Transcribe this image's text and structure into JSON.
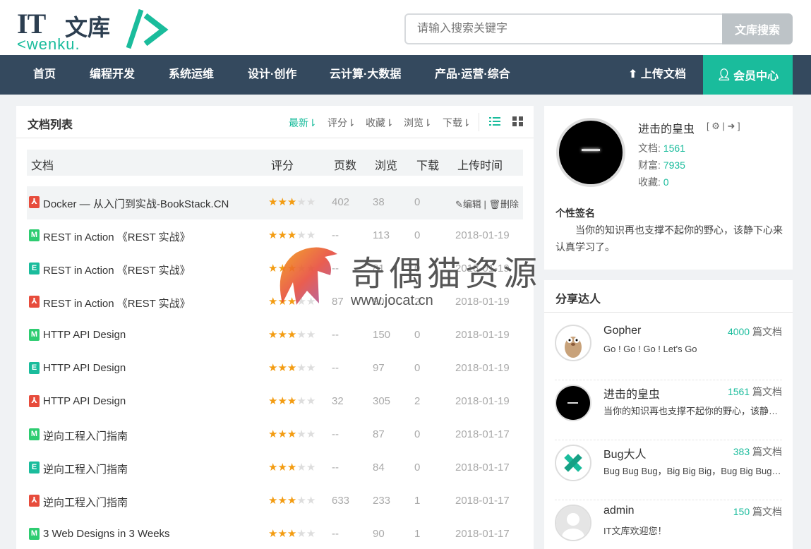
{
  "logo": {
    "brand_cn": "文库",
    "brand_en": "<wenku.",
    "brand_it": "IT"
  },
  "search": {
    "placeholder": "请输入搜索关键字",
    "button": "文库搜索"
  },
  "nav": {
    "items": [
      "首页",
      "编程开发",
      "系统运维",
      "设计·创作",
      "云计算·大数据",
      "产品·运营·综合"
    ],
    "upload": "上传文档",
    "member": "会员中心"
  },
  "doclist": {
    "title": "文档列表",
    "sorts": [
      "最新",
      "评分",
      "收藏",
      "浏览",
      "下载"
    ],
    "columns": [
      "文档",
      "评分",
      "页数",
      "浏览",
      "下载",
      "上传时间"
    ],
    "edit_label": "编辑",
    "delete_label": "删除",
    "rows": [
      {
        "type": "pdf",
        "title": "Docker — 从入门到实战-BookStack.CN",
        "rating": 3,
        "pages": "402",
        "views": "38",
        "downloads": "0",
        "date": ""
      },
      {
        "type": "md",
        "title": "REST in Action 《REST 实战》",
        "rating": 3,
        "pages": "--",
        "views": "113",
        "downloads": "0",
        "date": "2018-01-19"
      },
      {
        "type": "ep",
        "title": "REST in Action 《REST 实战》",
        "rating": 3,
        "pages": "--",
        "views": "81",
        "downloads": "0",
        "date": "2018-01-19"
      },
      {
        "type": "pdf",
        "title": "REST in Action 《REST 实战》",
        "rating": 3,
        "pages": "87",
        "views": "90",
        "downloads": "2",
        "date": "2018-01-19"
      },
      {
        "type": "md",
        "title": "HTTP API Design",
        "rating": 3,
        "pages": "--",
        "views": "150",
        "downloads": "0",
        "date": "2018-01-19"
      },
      {
        "type": "ep",
        "title": "HTTP API Design",
        "rating": 3,
        "pages": "--",
        "views": "97",
        "downloads": "0",
        "date": "2018-01-19"
      },
      {
        "type": "pdf",
        "title": "HTTP API Design",
        "rating": 3,
        "pages": "32",
        "views": "305",
        "downloads": "2",
        "date": "2018-01-19"
      },
      {
        "type": "md",
        "title": "逆向工程入门指南",
        "rating": 3,
        "pages": "--",
        "views": "87",
        "downloads": "0",
        "date": "2018-01-17"
      },
      {
        "type": "ep",
        "title": "逆向工程入门指南",
        "rating": 3,
        "pages": "--",
        "views": "84",
        "downloads": "0",
        "date": "2018-01-17"
      },
      {
        "type": "pdf",
        "title": "逆向工程入门指南",
        "rating": 3,
        "pages": "633",
        "views": "233",
        "downloads": "1",
        "date": "2018-01-17"
      },
      {
        "type": "md",
        "title": "3 Web Designs in 3 Weeks",
        "rating": 3,
        "pages": "--",
        "views": "90",
        "downloads": "1",
        "date": "2018-01-17"
      }
    ]
  },
  "profile": {
    "name": "进击的皇虫",
    "docs_label": "文档:",
    "docs": "1561",
    "wealth_label": "财富:",
    "wealth": "7935",
    "fav_label": "收藏:",
    "fav": "0",
    "sig_title": "个性签名",
    "signature": "当你的知识再也支撑不起你的野心，该静下心来认真学习了。"
  },
  "share": {
    "title": "分享达人",
    "unit": "篇文档",
    "users": [
      {
        "name": "Gopher",
        "count": "4000",
        "desc": "Go ! Go ! Go ! Let's Go",
        "avatar": "gopher-avatar"
      },
      {
        "name": "进击的皇虫",
        "count": "1561",
        "desc": "当你的知识再也支撑不起你的野心，该静下心来认真学习了。",
        "avatar": "dark-avatar"
      },
      {
        "name": "Bug大人",
        "count": "383",
        "desc": "Bug Bug Bug，Big Big Big，Bug Big Bug Big",
        "avatar": "tools-avatar"
      },
      {
        "name": "admin",
        "count": "150",
        "desc": "IT文库欢迎您！",
        "avatar": "default-avatar"
      }
    ]
  },
  "watermark": {
    "text": "奇偶猫资源",
    "url": "www.jocat.cn"
  },
  "colors": {
    "accent": "#1abc9c",
    "nav": "#34495e",
    "star": "#f39c12",
    "pdf": "#e74c3c"
  }
}
